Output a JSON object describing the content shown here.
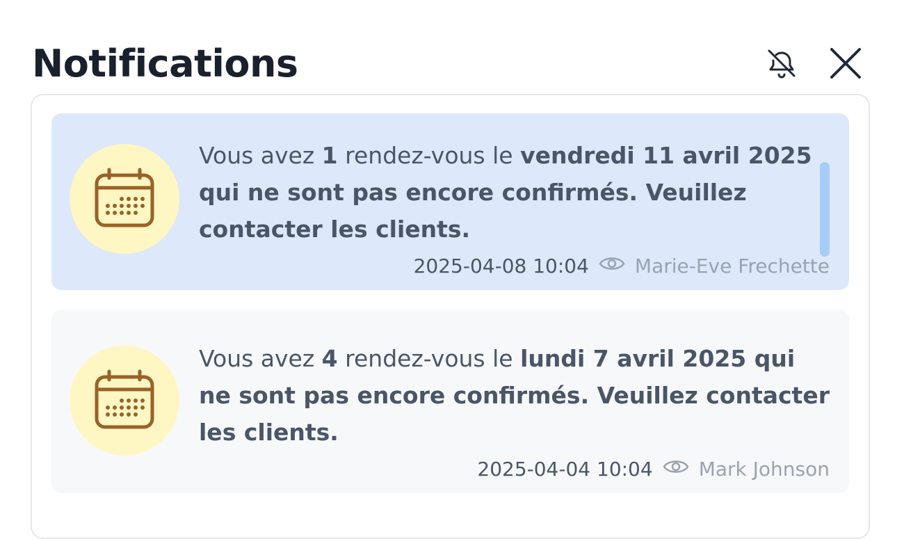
{
  "header": {
    "title": "Notifications",
    "mute_icon": "bell-off-icon",
    "close_icon": "close-icon"
  },
  "notifications": [
    {
      "state": "unread",
      "icon": "calendar-icon",
      "text_1": "Vous avez ",
      "count": "1",
      "text_2": " rendez-vous le ",
      "bold": "vendredi 11 avril 2025 qui ne sont pas encore confirmés. Veuillez contacter les clients.",
      "date": "2025-04-08 10:04",
      "seen_icon": "eye-icon",
      "author": "Marie-Eve Frechette"
    },
    {
      "state": "read",
      "icon": "calendar-icon",
      "text_1": "Vous avez ",
      "count": "4",
      "text_2": " rendez-vous le ",
      "bold": "lundi 7 avril 2025 qui ne sont pas encore confirmés. Veuillez contacter les clients.",
      "date": "2025-04-04 10:04",
      "seen_icon": "eye-icon",
      "author": "Mark Johnson"
    }
  ],
  "colors": {
    "unread_bg": "#dde8fa",
    "read_bg": "#f7f8fa",
    "avatar_bg": "#fef7c3",
    "calendar_stroke": "#9a6228",
    "scrollbar": "#a6cdf8"
  }
}
